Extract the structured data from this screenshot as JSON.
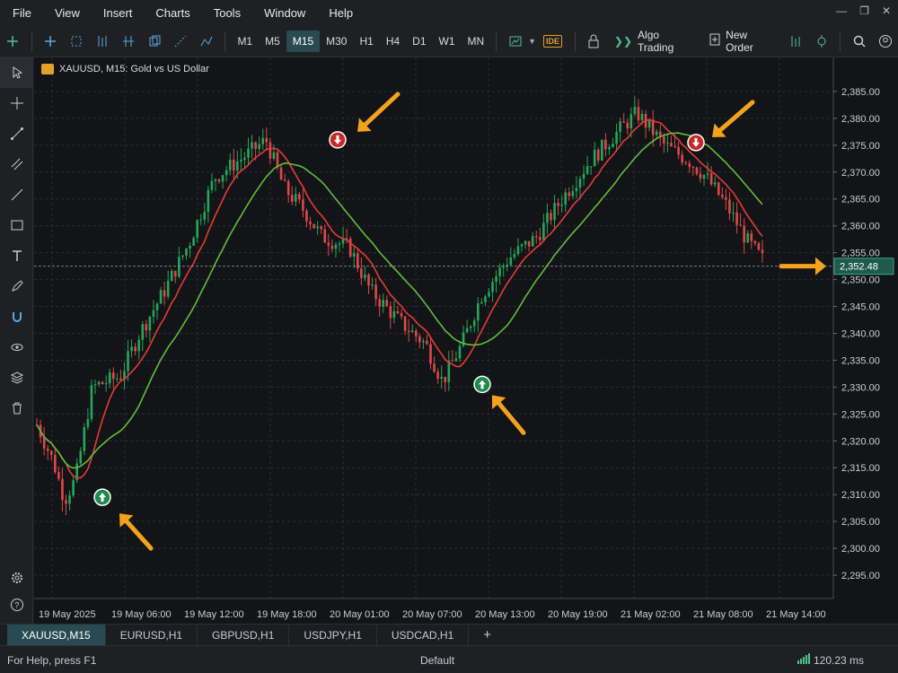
{
  "menu": [
    "File",
    "View",
    "Insert",
    "Charts",
    "Tools",
    "Window",
    "Help"
  ],
  "toolbar": {
    "timeframes": [
      "M1",
      "M5",
      "M15",
      "M30",
      "H1",
      "H4",
      "D1",
      "W1",
      "MN"
    ],
    "active_timeframe": "M15",
    "ide_label": "IDE",
    "algo_trading_label": "Algo Trading",
    "new_order_label": "New Order"
  },
  "chart": {
    "title": "XAUUSD, M15:  Gold vs US Dollar",
    "current_price": "2,352.48",
    "price_ticks": [
      "2,385.00",
      "2,380.00",
      "2,375.00",
      "2,370.00",
      "2,365.00",
      "2,360.00",
      "2,355.00",
      "2,350.00",
      "2,345.00",
      "2,340.00",
      "2,335.00",
      "2,330.00",
      "2,325.00",
      "2,320.00",
      "2,315.00",
      "2,310.00",
      "2,305.00",
      "2,300.00",
      "2,295.00"
    ],
    "time_ticks": [
      "19 May 2025",
      "19 May 06:00",
      "19 May 12:00",
      "19 May 18:00",
      "20 May 01:00",
      "20 May 07:00",
      "20 May 13:00",
      "20 May 19:00",
      "21 May 02:00",
      "21 May 08:00",
      "21 May 14:00"
    ],
    "colors": {
      "bull": "#26a65b",
      "bear": "#e04848",
      "fast_ma": "#e63b35",
      "slow_ma": "#5fbf3a",
      "arrow": "#f4a21e",
      "grid": "#2a2d32"
    }
  },
  "tabs": [
    "XAUUSD,M15",
    "EURUSD,H1",
    "GBPUSD,H1",
    "USDJPY,H1",
    "USDCAD,H1"
  ],
  "tab_add_label": "+",
  "status": {
    "help": "For Help, press F1",
    "profile": "Default",
    "ping": "120.23 ms"
  }
}
